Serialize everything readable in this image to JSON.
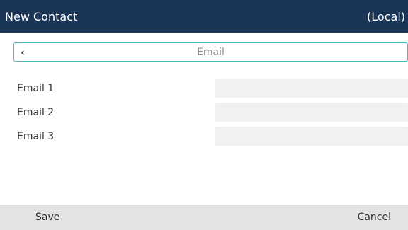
{
  "header": {
    "title": "New Contact",
    "location": "(Local)"
  },
  "nav": {
    "back_icon": "chevron-left-icon",
    "title": "Email"
  },
  "fields": [
    {
      "label": "Email 1",
      "value": ""
    },
    {
      "label": "Email 2",
      "value": ""
    },
    {
      "label": "Email 3",
      "value": ""
    }
  ],
  "softkeys": {
    "save_label": "Save",
    "cancel_label": "Cancel"
  },
  "colors": {
    "header_bg": "#1b3557",
    "nav_border": "#4eb3c9",
    "field_bg": "#f1f1f1",
    "softkey_bg": "#e3e3e3"
  }
}
